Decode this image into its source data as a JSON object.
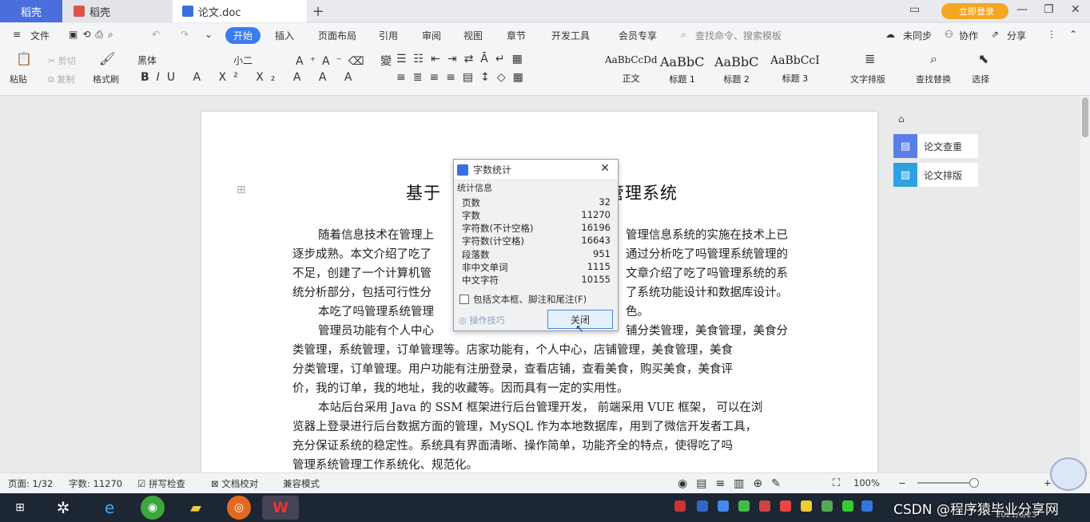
{
  "tabs": {
    "home": "稻壳",
    "draft": "稻壳",
    "doc": "论文.doc",
    "add": "+"
  },
  "vip_badge": "立即登录",
  "menus": [
    "文件",
    "开始",
    "插入",
    "页面布局",
    "引用",
    "审阅",
    "视图",
    "章节",
    "开发工具",
    "会员专享",
    "查找命令、搜索模板"
  ],
  "menu_right": {
    "sync": "未同步",
    "collab": "协作",
    "share": "分享"
  },
  "ribbon": {
    "paste": "粘贴",
    "cut": "剪切",
    "copy": "复制",
    "format_painter": "格式刷",
    "font": "黑体",
    "size": "小二",
    "styles": [
      {
        "preview": "AaBbCcDd",
        "label": "正文"
      },
      {
        "preview": "AaBbC",
        "label": "标题 1"
      },
      {
        "preview": "AaBbC",
        "label": "标题 2"
      },
      {
        "preview": "AaBbCcI",
        "label": "标题 3"
      }
    ],
    "text_layout": "文字排版",
    "find_replace": "查找替换",
    "select": "选择"
  },
  "document": {
    "title_left": "基于",
    "title_right": "管理系统",
    "paragraphs": [
      "随着信息技术在管理上",
      "逐步成熟。本文介绍了吃了",
      "不足，创建了一个计算机管",
      "统分析部分，包括可行性分",
      "本吃了吗管理系统管理",
      "管理员功能有个人中心",
      "类管理，系统管理，订单管理等。店家功能有，个人中心，店铺管理，美食管理，美食",
      "分类管理，订单管理。用户功能有注册登录，查看店铺，查看美食，购买美食，美食评",
      "价，我的订单，我的地址，我的收藏等。因而具有一定的实用性。",
      "本站后台采用 Java 的 SSM 框架进行后台管理开发， 前端采用 VUE 框架， 可以在浏",
      "览器上登录进行后台数据方面的管理，MySQL 作为本地数据库，用到了微信开发者工具，",
      "充分保证系统的稳定性。系统具有界面清晰、操作简单，功能齐全的特点，使得吃了吗",
      "管理系统管理工作系统化、规范化。"
    ],
    "right_fragments": [
      "管理信息系统的实施在技术上已",
      "通过分析吃了吗管理系统管理的",
      "文章介绍了吃了吗管理系统的系",
      "了系统功能设计和数据库设计。",
      "色。",
      "铺分类管理，美食管理，美食分"
    ]
  },
  "side_panel": {
    "check": "论文查重",
    "layout": "论文排版"
  },
  "dialog": {
    "title": "字数统计",
    "group": "统计信息",
    "stats": [
      {
        "label": "页数",
        "value": "32"
      },
      {
        "label": "字数",
        "value": "11270"
      },
      {
        "label": "字符数(不计空格)",
        "value": "16196"
      },
      {
        "label": "字符数(计空格)",
        "value": "16643"
      },
      {
        "label": "段落数",
        "value": "951"
      },
      {
        "label": "非中文单词",
        "value": "1115"
      },
      {
        "label": "中文字符",
        "value": "10155"
      }
    ],
    "include_textbox": "包括文本框、脚注和尾注(F)",
    "tips": "操作技巧",
    "close_button": "关闭"
  },
  "status": {
    "page": "页面: 1/32",
    "words": "字数: 11270",
    "spell": "拼写检查",
    "proof": "文档校对",
    "compat": "兼容模式",
    "zoom": "100%"
  },
  "taskbar": {
    "watermark": "CSDN @程序猿毕业分享网",
    "date": "2021/6/23"
  }
}
